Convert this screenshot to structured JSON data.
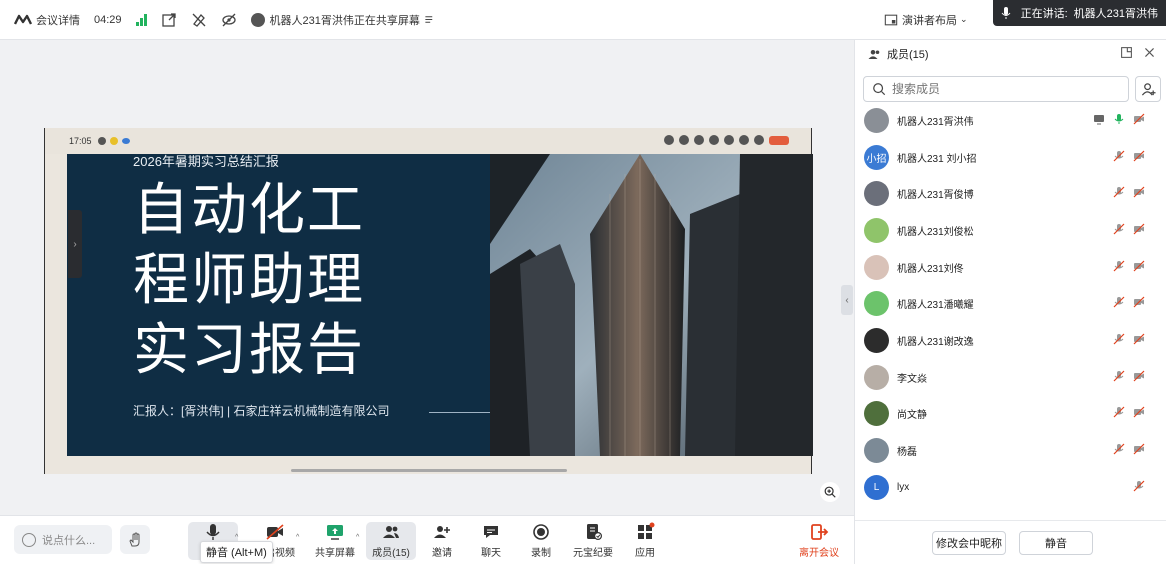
{
  "topbar": {
    "meeting_details": "会议详情",
    "duration": "04:29",
    "sharing_status": "机器人231胥洪伟正在共享屏幕"
  },
  "topbar_right": {
    "layout_label": "演讲者布局",
    "speaking_label": "正在讲话:",
    "speaking_name": "机器人231胥洪伟"
  },
  "share": {
    "phone_time": "17:05",
    "slide_subtitle": "2026年暑期实习总结汇报",
    "slide_title_1": "自动化工",
    "slide_title_2": "程师助理",
    "slide_title_3": "实习报告",
    "reporter": "汇报人：[胥洪伟] | 石家庄祥云机械制造有限公司"
  },
  "toolbar": {
    "chat_placeholder": "说点什么...",
    "mute_tooltip": "静音 (Alt+M)",
    "video_label": "开启视频",
    "share_label": "共享屏幕",
    "members_label": "成员(15)",
    "invite_label": "邀请",
    "chat_label": "聊天",
    "record_label": "录制",
    "summary_label": "元宝纪要",
    "apps_label": "应用",
    "leave_label": "离开会议"
  },
  "panel": {
    "title": "成员(15)",
    "search_placeholder": "搜索成员",
    "rename_button": "修改会中昵称",
    "mute_button": "静音",
    "members": [
      {
        "name": "机器人231胥洪伟",
        "avatar_color": "#8a8f96",
        "initial": ""
      },
      {
        "name": "机器人231 刘小招",
        "avatar_color": "#3b7bd4",
        "initial": "小招"
      },
      {
        "name": "机器人231胥俊博",
        "avatar_color": "#6b6f7a",
        "initial": ""
      },
      {
        "name": "机器人231刘俊松",
        "avatar_color": "#8fc46a",
        "initial": ""
      },
      {
        "name": "机器人231刘佟",
        "avatar_color": "#d9c2b8",
        "initial": ""
      },
      {
        "name": "机器人231潘曦耀",
        "avatar_color": "#6cc36b",
        "initial": ""
      },
      {
        "name": "机器人231谢改逸",
        "avatar_color": "#2c2c2c",
        "initial": ""
      },
      {
        "name": "李文焱",
        "avatar_color": "#b7aea6",
        "initial": ""
      },
      {
        "name": "尚文静",
        "avatar_color": "#4f6f3c",
        "initial": ""
      },
      {
        "name": "杨磊",
        "avatar_color": "#7c8a96",
        "initial": ""
      },
      {
        "name": "lyx",
        "avatar_color": "#2f6fd1",
        "initial": "L"
      }
    ]
  }
}
